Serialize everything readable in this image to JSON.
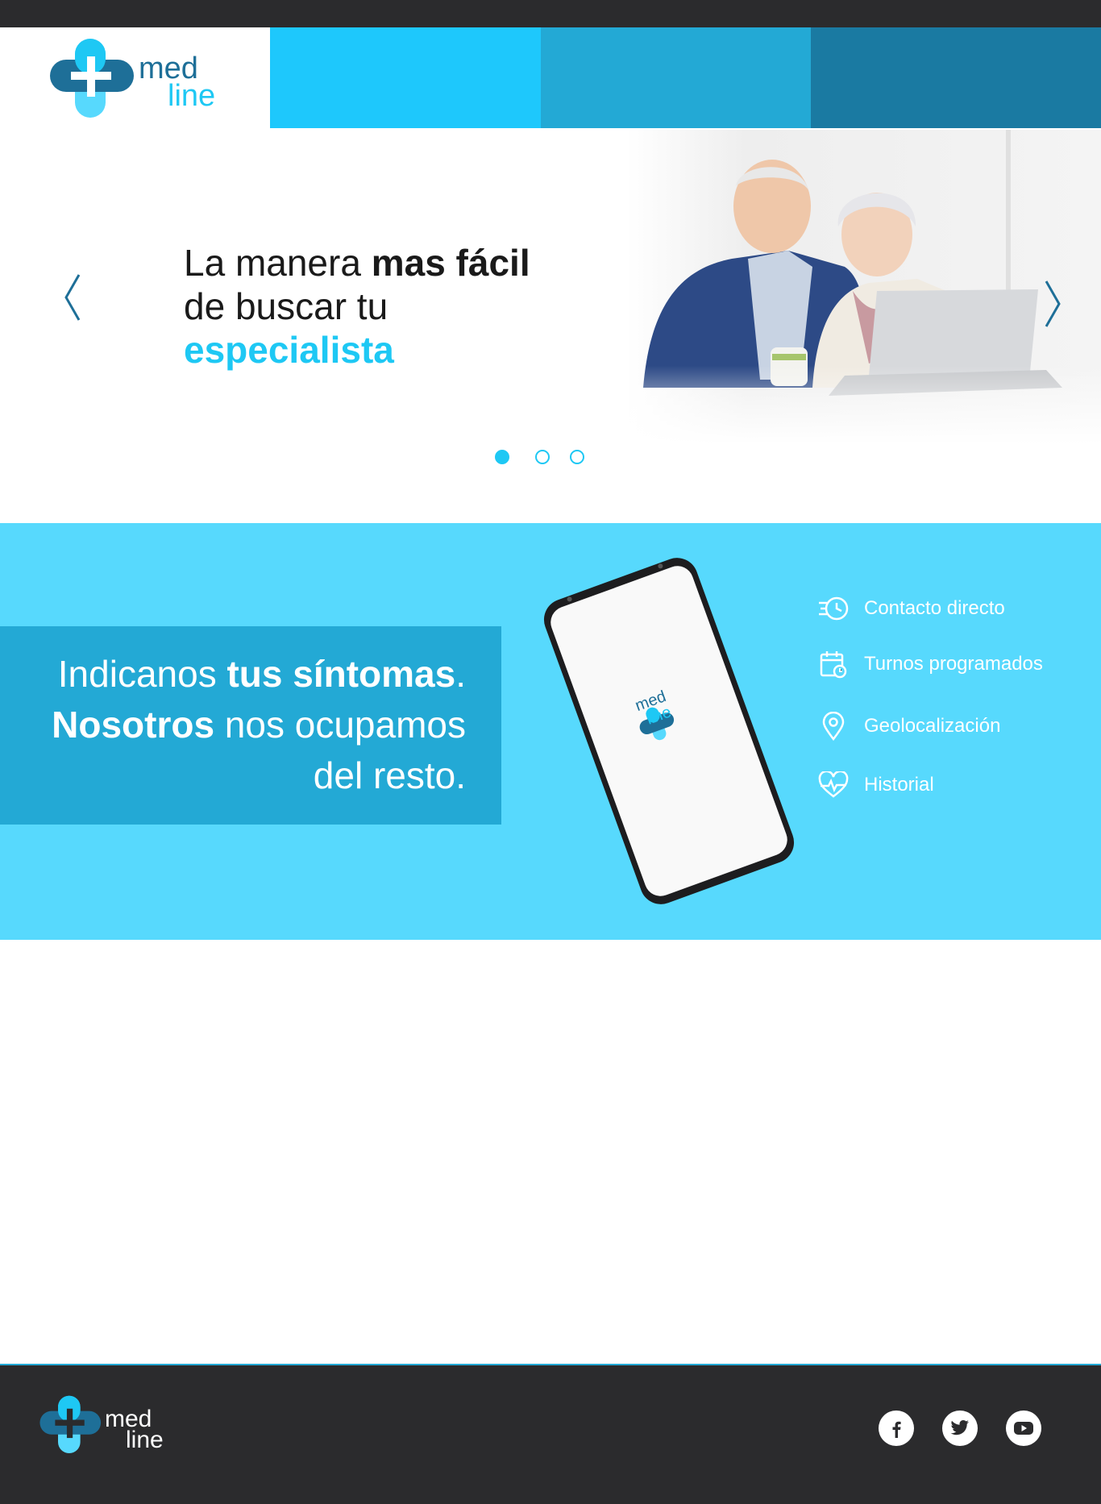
{
  "brand": {
    "name_line1": "med",
    "name_line2": "line",
    "primary_color": "#1e6f98",
    "accent_color": "#1ec8f4"
  },
  "header": {
    "nav_tiles": [
      {
        "color": "#1ec8fc"
      },
      {
        "color": "#23a9d5"
      },
      {
        "color": "#1a7aa2"
      }
    ]
  },
  "hero": {
    "line1_normal": "La manera ",
    "line1_bold": "mas fácil",
    "line2": "de buscar tu",
    "line3_accent": "especialista",
    "prev_icon": "chevron-left-icon",
    "next_icon": "chevron-right-icon",
    "slides_total": 3,
    "active_slide": 1
  },
  "features": {
    "tagline": {
      "l1_normal": "Indicanos ",
      "l1_bold": "tus síntomas",
      "l1_end": ".",
      "l2_bold": "Nosotros",
      "l2_normal": " nos ocupamos",
      "l3": "del resto."
    },
    "phone_app_name1": "med",
    "phone_app_name2": "line",
    "items": [
      {
        "label": "Contacto directo",
        "icon": "fast-clock-icon"
      },
      {
        "label": "Turnos programados",
        "icon": "calendar-clock-icon"
      },
      {
        "label": "Geolocalización",
        "icon": "location-pin-icon"
      },
      {
        "label": "Historial",
        "icon": "heart-pulse-icon"
      }
    ]
  },
  "footer": {
    "name_line1": "med",
    "name_line2": "line",
    "social": [
      {
        "name": "facebook",
        "icon": "facebook-icon"
      },
      {
        "name": "twitter",
        "icon": "twitter-icon"
      },
      {
        "name": "youtube",
        "icon": "youtube-icon"
      }
    ]
  }
}
